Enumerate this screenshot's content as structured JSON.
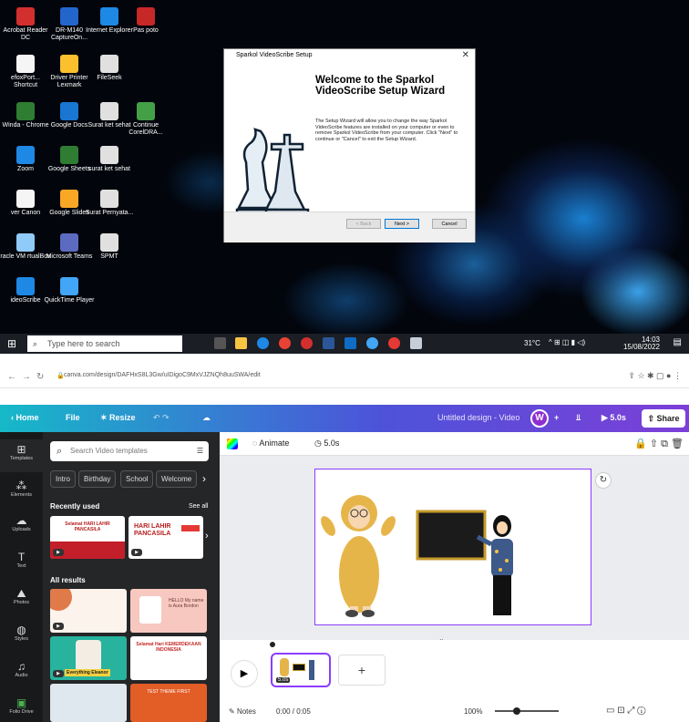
{
  "desktop": {
    "icons": [
      {
        "label": "Acrobat Reader DC",
        "color": "#d32f2f"
      },
      {
        "label": "DR-M140 CaptureOn...",
        "color": "#2266cc"
      },
      {
        "label": "Internet Explorer",
        "color": "#1e88e5"
      },
      {
        "label": "Pas poto",
        "color": "#c62828"
      },
      {
        "label": "efoxPort... Shortcut",
        "color": "#f5f5f5"
      },
      {
        "label": "Driver Printer Lexmark",
        "color": "#fbc02d"
      },
      {
        "label": "FileSeek",
        "color": "#e0e0e0"
      },
      {
        "label": "Winda - Chrome",
        "color": "#2e7d32"
      },
      {
        "label": "Google Docs",
        "color": "#1976d2"
      },
      {
        "label": "Surat ket sehat",
        "color": "#e0e0e0"
      },
      {
        "label": "Continue CorelDRA...",
        "color": "#43a047"
      },
      {
        "label": "Zoom",
        "color": "#1e88e5"
      },
      {
        "label": "Google Sheets",
        "color": "#2e7d32"
      },
      {
        "label": "surat ket sehat",
        "color": "#e0e0e0"
      },
      {
        "label": "ver Canon",
        "color": "#f5f5f5"
      },
      {
        "label": "Google Slides",
        "color": "#f9a825"
      },
      {
        "label": "Surat Pernyata...",
        "color": "#e0e0e0"
      },
      {
        "label": "racle VM rtualBox",
        "color": "#90caf9"
      },
      {
        "label": "Microsoft Teams",
        "color": "#5c6bc0"
      },
      {
        "label": "SPMT",
        "color": "#e0e0e0"
      },
      {
        "label": "ideoScribe",
        "color": "#1e88e5"
      },
      {
        "label": "QuickTime Player",
        "color": "#42a5f5"
      }
    ],
    "dialog": {
      "title": "Sparkol VideoScribe Setup",
      "heading": "Welcome to the Sparkol VideoScribe Setup Wizard",
      "body": "The Setup Wizard will allow you to change the way Sparkol VideoScribe features are installed on your computer or even to remove Sparkol VideoScribe from your computer.  Click \"Next\" to continue or \"Cancel\" to exit the Setup Wizard.",
      "back": "< Back",
      "next": "Next >",
      "cancel": "Cancel"
    },
    "taskbar": {
      "search_placeholder": "Type here to search",
      "weather": "31°C",
      "time": "14:03",
      "date": "15/08/2022"
    }
  },
  "browser": {
    "url": "canva.com/design/DAFHxS8L3Gw/uIDigoC9MxVJZNQh8uuSWA/edit"
  },
  "canva": {
    "top": {
      "home": "Home",
      "file": "File",
      "resize": "Resize",
      "title": "Untitled design - Video",
      "avatar": "W",
      "play": "5.0s",
      "share": "Share"
    },
    "rail": [
      "Templates",
      "Elements",
      "Uploads",
      "Text",
      "Photos",
      "Styles",
      "Audio",
      "Folio Drive"
    ],
    "panel": {
      "search_placeholder": "Search Video templates",
      "chips": [
        "Intro",
        "Birthday",
        "School",
        "Welcome"
      ],
      "recent": "Recently used",
      "see_all": "See all",
      "all_results": "All results",
      "thumb_texts": [
        "Selamat HARI LAHIR PANCASILA",
        "HARI LAHIR PANCASILA",
        "Everything Eleanor",
        "Selamat Hari KEMERDEKAAN INDONESIA",
        "HELLO My name is Aura Bordon",
        "TEST THEME FIRST"
      ]
    },
    "toolbar": {
      "animate": "Animate",
      "duration": "5.0s"
    },
    "timeline": {
      "clip": "5.0s"
    },
    "footer": {
      "notes": "Notes",
      "time": "0:00 / 0:05",
      "zoom": "100%"
    }
  }
}
